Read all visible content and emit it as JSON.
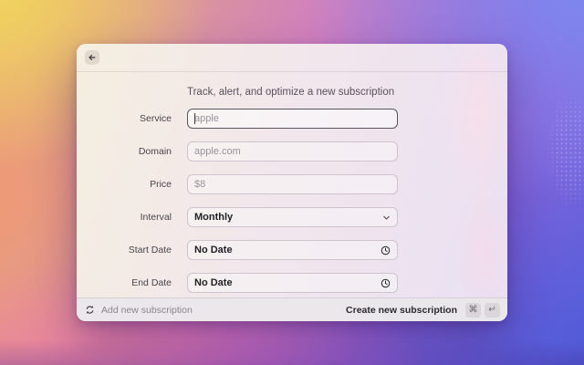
{
  "dialog": {
    "header": {
      "back_icon": "arrow-left"
    },
    "title": "Track, alert, and optimize a new subscription",
    "form": {
      "fields": [
        {
          "label": "Service",
          "type": "text",
          "placeholder": "apple",
          "value": "",
          "focused": true
        },
        {
          "label": "Domain",
          "type": "text",
          "placeholder": "apple.com",
          "value": ""
        },
        {
          "label": "Price",
          "type": "text",
          "placeholder": "$8",
          "value": ""
        },
        {
          "label": "Interval",
          "type": "select",
          "value": "Monthly",
          "icon": "chevron-down-icon"
        },
        {
          "label": "Start Date",
          "type": "date",
          "value": "No Date",
          "icon": "clock-icon"
        },
        {
          "label": "End Date",
          "type": "date",
          "value": "No Date",
          "icon": "clock-icon"
        }
      ]
    },
    "footer": {
      "left_icon": "sync-icon",
      "left_label": "Add new subscription",
      "primary_action": "Create new subscription",
      "shortcut_keys": [
        "⌘",
        "↵"
      ]
    }
  },
  "colors": {
    "focus_border": "#58555c",
    "field_border": "#cfc3cd",
    "placeholder_text": "#98949c",
    "footer_bg": "#eae7ea",
    "value_text": "#201f23"
  }
}
